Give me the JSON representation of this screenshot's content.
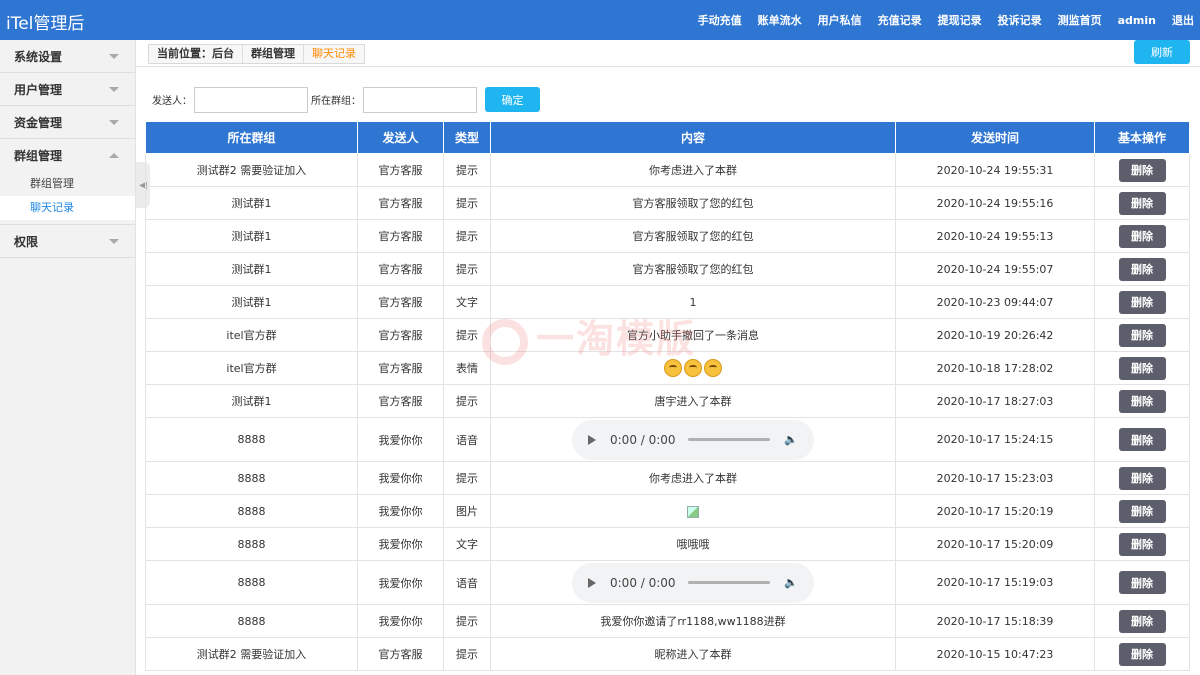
{
  "brand": "iTel管理后",
  "topnav": [
    "手动充值",
    "账单流水",
    "用户私信",
    "充值记录",
    "提现记录",
    "投诉记录",
    "测监首页",
    "admin",
    "退出"
  ],
  "sidebar": {
    "groups": [
      {
        "label": "系统设置",
        "expanded": false
      },
      {
        "label": "用户管理",
        "expanded": false
      },
      {
        "label": "资金管理",
        "expanded": false
      },
      {
        "label": "群组管理",
        "expanded": true,
        "items": [
          "群组管理",
          "聊天记录"
        ],
        "active_item": "聊天记录"
      },
      {
        "label": "权限",
        "expanded": false
      }
    ],
    "toggle_icon": "chevron-left-icon"
  },
  "breadcrumb": {
    "items": [
      "当前位置：后台",
      "群组管理",
      "聊天记录"
    ]
  },
  "refresh_label": "刷新",
  "filter": {
    "sender_label": "发送人：",
    "sender_value": "",
    "group_label": "所在群组：",
    "group_value": "",
    "confirm_label": "确定"
  },
  "table": {
    "columns": [
      "所在群组",
      "发送人",
      "类型",
      "内容",
      "发送时间",
      "基本操作"
    ],
    "delete_label": "删除",
    "rows": [
      {
        "group": "测试群2 需要验证加入",
        "sender": "官方客服",
        "type": "提示",
        "content": "你考虑进入了本群",
        "time": "2020-10-24 19:55:31",
        "kind": "text"
      },
      {
        "group": "测试群1",
        "sender": "官方客服",
        "type": "提示",
        "content": "官方客服领取了您的红包",
        "time": "2020-10-24 19:55:16",
        "kind": "text"
      },
      {
        "group": "测试群1",
        "sender": "官方客服",
        "type": "提示",
        "content": "官方客服领取了您的红包",
        "time": "2020-10-24 19:55:13",
        "kind": "text"
      },
      {
        "group": "测试群1",
        "sender": "官方客服",
        "type": "提示",
        "content": "官方客服领取了您的红包",
        "time": "2020-10-24 19:55:07",
        "kind": "text"
      },
      {
        "group": "测试群1",
        "sender": "官方客服",
        "type": "文字",
        "content": "1",
        "time": "2020-10-23 09:44:07",
        "kind": "text"
      },
      {
        "group": "itel官方群",
        "sender": "官方客服",
        "type": "提示",
        "content": "官方小助手撤回了一条消息",
        "time": "2020-10-19 20:26:42",
        "kind": "text"
      },
      {
        "group": "itel官方群",
        "sender": "官方客服",
        "type": "表情",
        "content": "",
        "time": "2020-10-18 17:28:02",
        "kind": "emoji"
      },
      {
        "group": "测试群1",
        "sender": "官方客服",
        "type": "提示",
        "content": "唐宇进入了本群",
        "time": "2020-10-17 18:27:03",
        "kind": "text"
      },
      {
        "group": "8888",
        "sender": "我爱你你",
        "type": "语音",
        "content": "0:00 / 0:00",
        "time": "2020-10-17 15:24:15",
        "kind": "audio"
      },
      {
        "group": "8888",
        "sender": "我爱你你",
        "type": "提示",
        "content": "你考虑进入了本群",
        "time": "2020-10-17 15:23:03",
        "kind": "text"
      },
      {
        "group": "8888",
        "sender": "我爱你你",
        "type": "图片",
        "content": "",
        "time": "2020-10-17 15:20:19",
        "kind": "image"
      },
      {
        "group": "8888",
        "sender": "我爱你你",
        "type": "文字",
        "content": "哦哦哦",
        "time": "2020-10-17 15:20:09",
        "kind": "text"
      },
      {
        "group": "8888",
        "sender": "我爱你你",
        "type": "语音",
        "content": "0:00 / 0:00",
        "time": "2020-10-17 15:19:03",
        "kind": "audio"
      },
      {
        "group": "8888",
        "sender": "我爱你你",
        "type": "提示",
        "content": "我爱你你邀请了rr1188,ww1188进群",
        "time": "2020-10-17 15:18:39",
        "kind": "text"
      },
      {
        "group": "测试群2 需要验证加入",
        "sender": "官方客服",
        "type": "提示",
        "content": "昵称进入了本群",
        "time": "2020-10-15 10:47:23",
        "kind": "text"
      }
    ]
  },
  "watermark": "一淘模版",
  "colors": {
    "header_blue": "#2f76d2",
    "button_cyan": "#1fb5f0",
    "delete_gray": "#5c5f6b",
    "active_link": "#1e88e5",
    "crumb_current": "#ff8a00"
  }
}
